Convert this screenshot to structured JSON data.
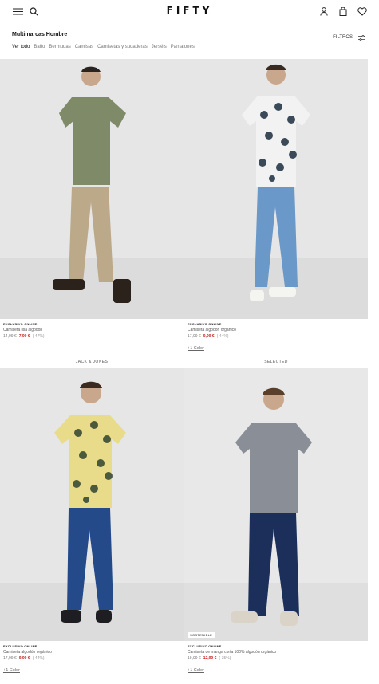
{
  "header": {
    "logo": "FIFTY",
    "icons": [
      "menu-icon",
      "search-icon",
      "user-icon",
      "bag-icon",
      "heart-icon"
    ]
  },
  "page": {
    "title": "Multimarcas Hombre",
    "filters_label": "FILTROS"
  },
  "categories": [
    "Ver todo",
    "Baño",
    "Bermudas",
    "Camisas",
    "Camisetas y sudaderas",
    "Jerséis",
    "Pantalones"
  ],
  "products": [
    {
      "exclusive": "EXCLUSIVO ONLINE",
      "name": "Camiseta lisa algodón",
      "old_price": "14,99 €",
      "new_price": "7,99 €",
      "discount": "(-47%)",
      "more_colors": "",
      "brand_below": "JACK & JONES",
      "badge": ""
    },
    {
      "exclusive": "EXCLUSIVO ONLINE",
      "name": "Camiseta algodón orgánico",
      "old_price": "17,99 €",
      "new_price": "9,99 €",
      "discount": "(-44%)",
      "more_colors": "+1 Color",
      "brand_below": "SELECTED",
      "badge": ""
    },
    {
      "exclusive": "EXCLUSIVO ONLINE",
      "name": "Camiseta algodón orgánico",
      "old_price": "17,99 €",
      "new_price": "9,99 €",
      "discount": "(-44%)",
      "more_colors": "+1 Color",
      "brand_below": "",
      "badge": ""
    },
    {
      "exclusive": "EXCLUSIVO ONLINE",
      "name": "Camiseta de manga corta 100% algodón orgánico",
      "old_price": "19,99 €",
      "new_price": "12,99 €",
      "discount": "(-35%)",
      "more_colors": "+1 Color",
      "brand_below": "",
      "badge": "SOSTENIBLE"
    }
  ],
  "colors": {
    "sale": "#c62828",
    "photo_bg": "#e4e4e4"
  }
}
